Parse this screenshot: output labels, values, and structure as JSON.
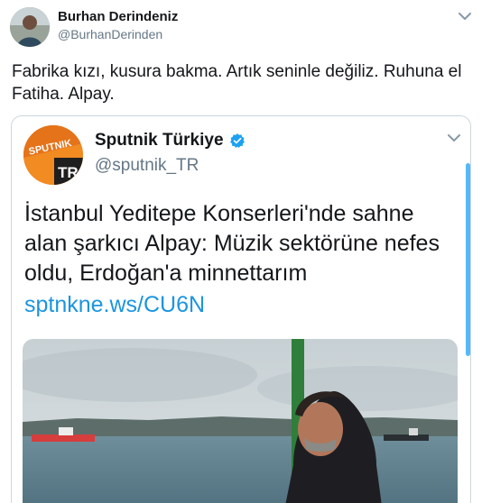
{
  "author": {
    "name": "Burhan Derindeniz",
    "handle": "@BurhanDerinden"
  },
  "tweet": {
    "text": "Fabrika kızı, kusura bakma. Artık seninle değiliz. Ruhuna el Fatiha. Alpay."
  },
  "quoted": {
    "avatar_logo_top": "SPUTNIK",
    "avatar_logo_bottom": "TR",
    "name": "Sputnik Türkiye",
    "handle": "@sputnik_TR",
    "text": "İstanbul Yeditepe Konserleri'nde sahne alan şarkıcı Alpay: Müzik sektörüne nefes oldu, Erdoğan'a minnettarım",
    "link": "sptnkne.ws/CU6N"
  },
  "icons": {
    "caret": "chevron-down-icon",
    "verified": "verified-badge-icon"
  },
  "colors": {
    "link": "#1b95e0",
    "handle": "#657786",
    "verified": "#1da1f2",
    "sputnik_orange": "#f18b22"
  }
}
